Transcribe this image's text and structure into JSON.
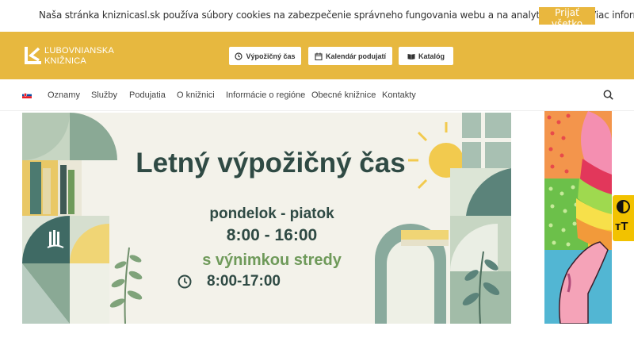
{
  "cookie": {
    "text": "Naša stránka kniznicasl.sk používa súbory cookies na zabezpečenie správneho fungovania webu a na analytické účely. Viac informácií",
    "accept_label": "Prijať všetko"
  },
  "header": {
    "logo_line1": "ĽUBOVNIANSKA",
    "logo_line2": "KNIŽNICA",
    "buttons": [
      {
        "label": "Výpožičný čas",
        "icon": "clock-icon"
      },
      {
        "label": "Kalendár podujatí",
        "icon": "calendar-icon"
      },
      {
        "label": "Katalóg",
        "icon": "book-icon"
      }
    ]
  },
  "nav": {
    "language": "sk",
    "items": [
      "Oznamy",
      "Služby",
      "Podujatia",
      "O knižnici",
      "Informácie o regióne",
      "Obecné knižnice",
      "Kontakty"
    ]
  },
  "banner": {
    "title": "Letný výpožičný čas",
    "days": "pondelok - piatok",
    "hours": "8:00 - 16:00",
    "exception": "s výnimkou stredy",
    "exception_hours": "8:00-17:00"
  },
  "accessibility": {
    "contrast_icon": "contrast-icon",
    "text_size_label": "тT"
  },
  "colors": {
    "header_bg": "#e7b83f",
    "accent": "#e9b73e",
    "banner_text": "#2f4a44",
    "banner_green": "#6f9a5a",
    "a11y_bg": "#f2c200"
  }
}
